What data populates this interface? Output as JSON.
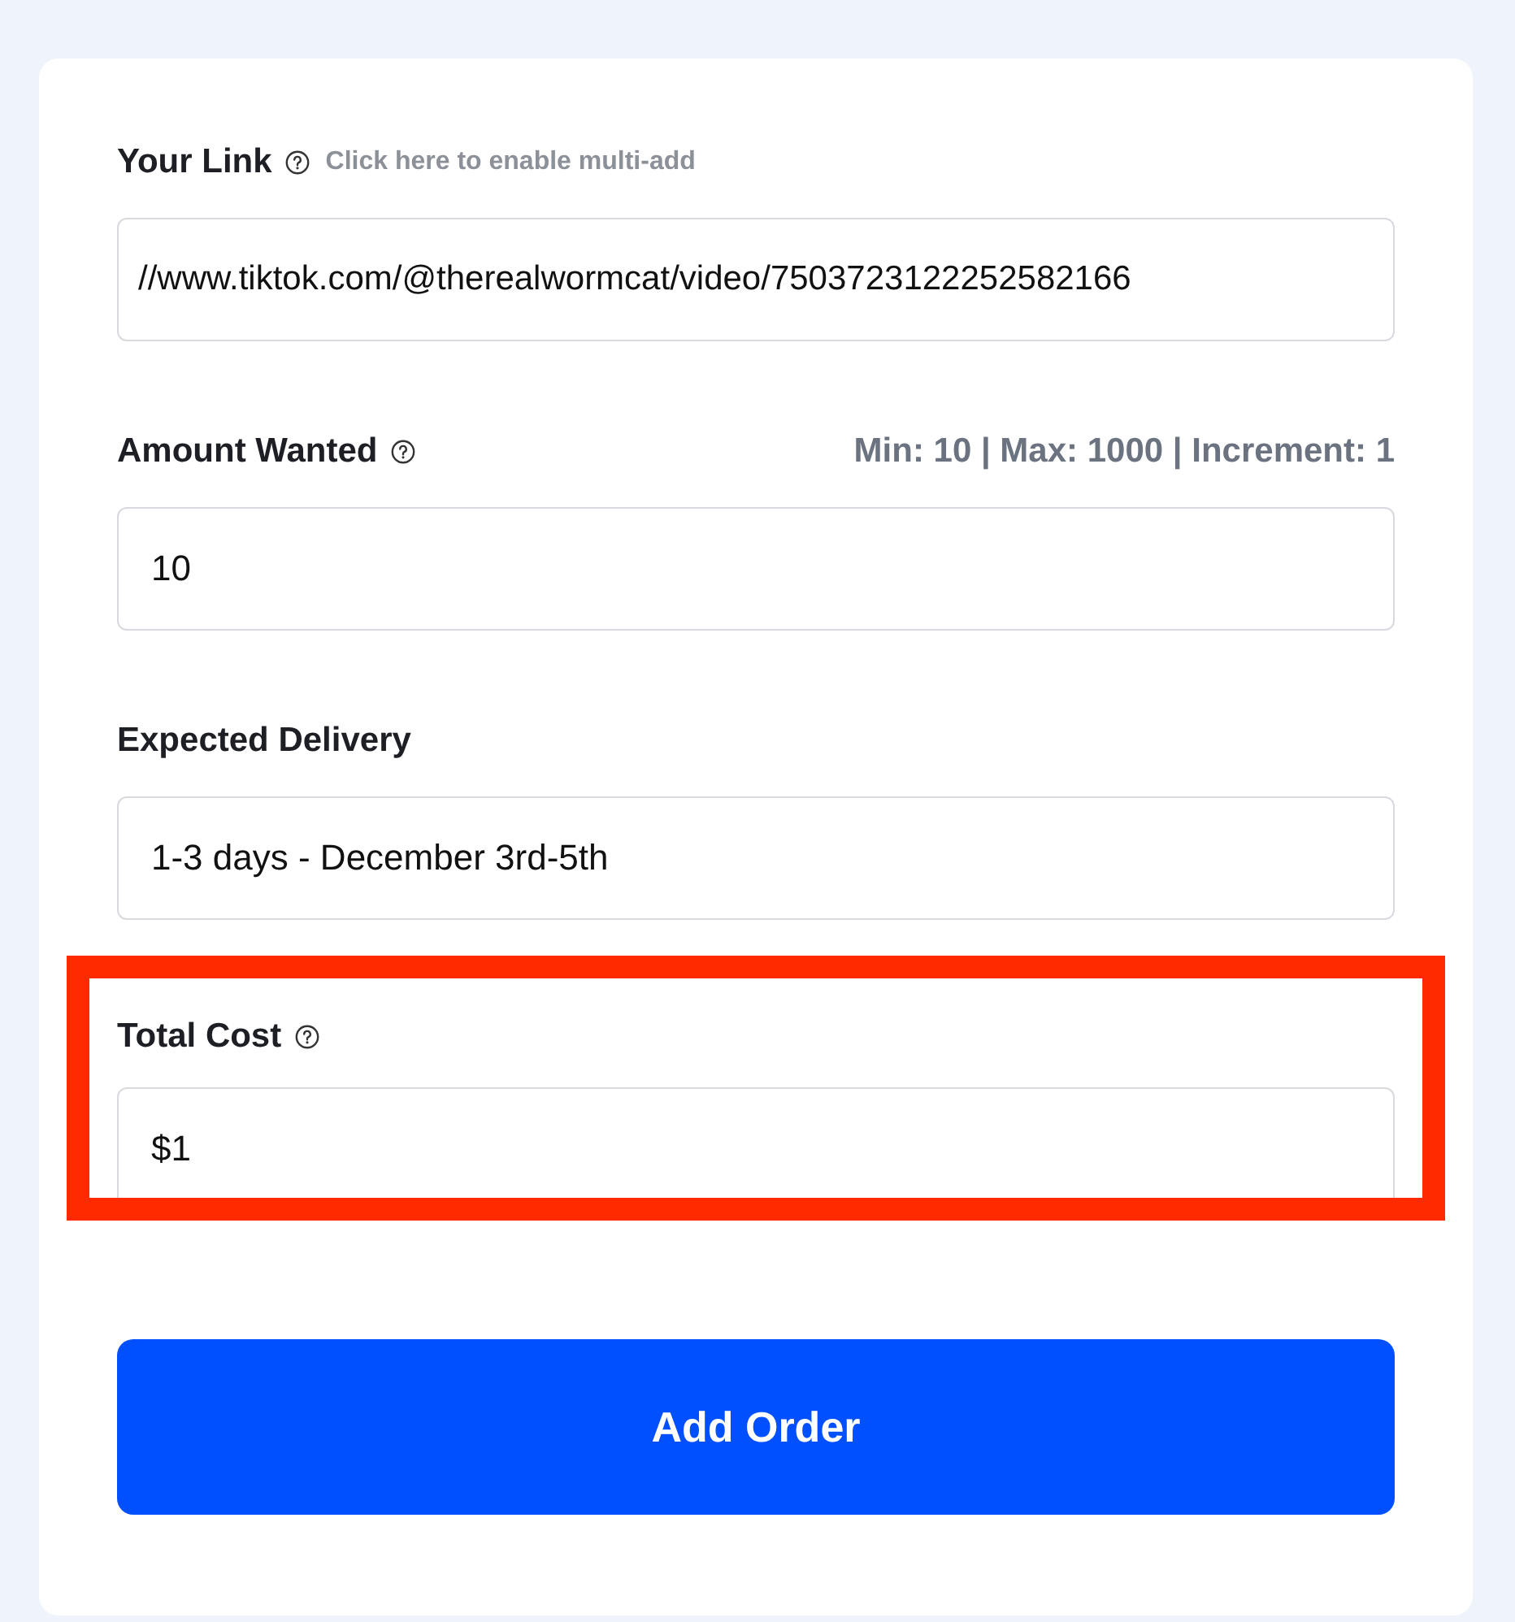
{
  "form": {
    "fields": [
      {
        "label": "Your Link",
        "help": true,
        "hint": "Click here to enable multi-add",
        "value": "//www.tiktok.com/@therealwormcat/video/7503723122252582166",
        "highlighted": false
      },
      {
        "label": "Amount Wanted",
        "help": true,
        "limits": "Min: 10 | Max: 1000 | Increment: 1",
        "value": "10",
        "highlighted": false
      },
      {
        "label": "Expected Delivery",
        "help": false,
        "value": "1-3 days - December 3rd-5th",
        "highlighted": false
      },
      {
        "label": "Total Cost",
        "help": true,
        "value": "$1",
        "highlighted": true
      }
    ],
    "submit_button": "Add Order"
  }
}
